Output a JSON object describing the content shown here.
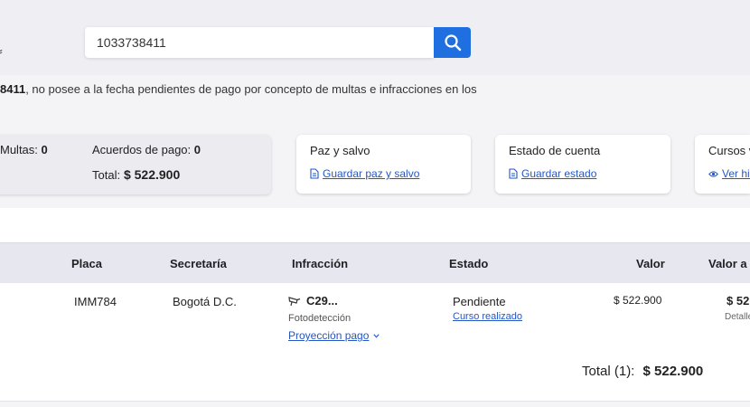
{
  "search": {
    "value": "1033738411"
  },
  "notice": {
    "bold_fragment": "8411",
    "text": ", no posee a la fecha pendientes de pago por concepto de multas e infracciones en los"
  },
  "summary": {
    "multas_label": "Multas:",
    "multas_value": "0",
    "acuerdos_label": "Acuerdos de pago:",
    "acuerdos_value": "0",
    "total_label": "Total:",
    "total_value": "$ 522.900"
  },
  "cards": {
    "paz_y_salvo": {
      "title": "Paz y salvo",
      "link": "Guardar paz y salvo"
    },
    "estado_cuenta": {
      "title": "Estado de cuenta",
      "link": "Guardar estado"
    },
    "cursos": {
      "title": "Cursos v",
      "link": "Ver his"
    }
  },
  "table": {
    "headers": {
      "placa": "Placa",
      "secretaria": "Secretaría",
      "infraccion": "Infracción",
      "estado": "Estado",
      "valor": "Valor",
      "valor_a_pagar": "Valor a p"
    },
    "rows": [
      {
        "placa": "IMM784",
        "secretaria": "Bogotá D.C.",
        "infraccion_code": "C29...",
        "infraccion_tipo": "Fotodetección",
        "proyeccion_link": "Proyección pago",
        "estado": "Pendiente",
        "estado_link": "Curso realizado",
        "valor": "$ 522.900",
        "valor_a_pagar": "$ 52",
        "valor_a_pagar_sub": "Detalle"
      }
    ],
    "total_label": "Total (1):",
    "total_value": "$ 522.900"
  },
  "icons": {
    "search": "search-icon",
    "document": "document-icon",
    "eye": "eye-icon",
    "camera": "camera-icon",
    "chevron": "chevron-down-icon"
  },
  "colors": {
    "accent": "#1f6fe0",
    "link": "#2456c4"
  }
}
